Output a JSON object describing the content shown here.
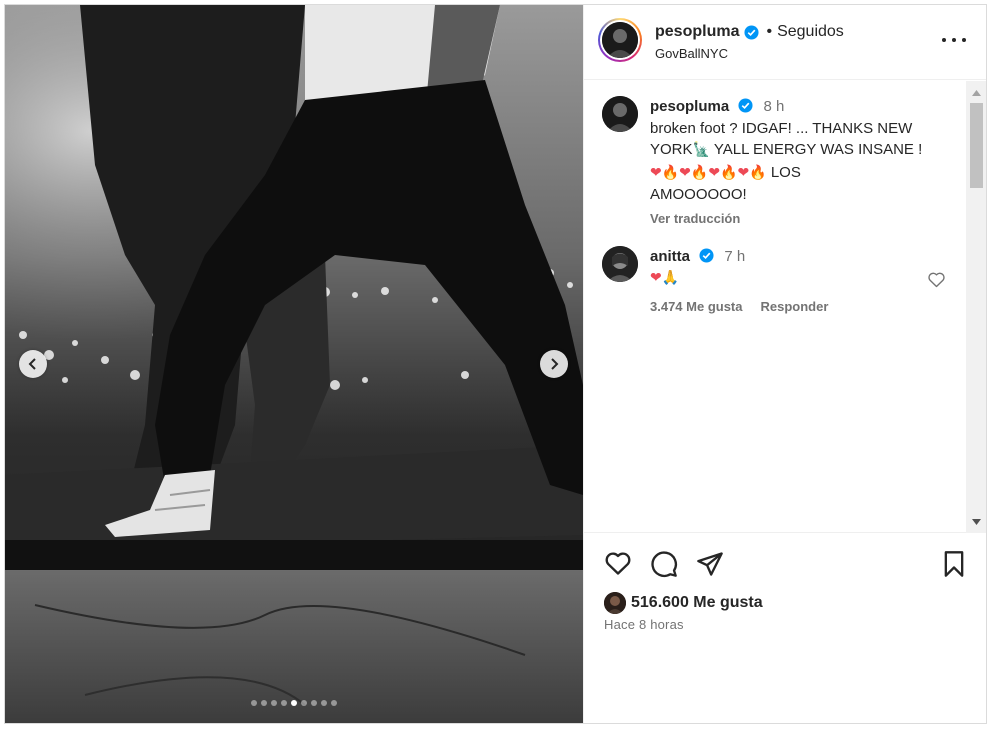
{
  "post": {
    "author": "pesopluma",
    "follow_separator": "•",
    "follow_status": "Seguidos",
    "location": "GovBallNYC",
    "carousel": {
      "total_slides": 9,
      "active_slide": 5
    },
    "likes_label": "516.600 Me gusta",
    "posted_ago": "Hace 8 horas"
  },
  "caption": {
    "user": "pesopluma",
    "time": "8 h",
    "text_line1": "broken foot ? IDGAF! ... THANKS NEW",
    "text_line2a": "YORK",
    "text_line2_emoji": "🗽",
    "text_line2b": " YALL ENERGY WAS INSANE !",
    "emoji_row": "❤🔥❤🔥❤🔥❤🔥",
    "text_line3": " LOS",
    "text_line4": "AMOOOOOO!",
    "translate": "Ver traducción"
  },
  "reply": {
    "user": "anitta",
    "time": "7 h",
    "text": "❤🙏",
    "likes": "3.474 Me gusta",
    "reply_label": "Responder"
  },
  "colors": {
    "verified": "#0095f6",
    "heart_red": "#ed4956",
    "fire": "#ff7a00"
  },
  "icons": {
    "prev": "chevron-left-icon",
    "next": "chevron-right-icon",
    "like": "heart-icon",
    "comment": "comment-icon",
    "share": "paper-plane-icon",
    "save": "bookmark-icon",
    "more": "more-options-icon"
  }
}
